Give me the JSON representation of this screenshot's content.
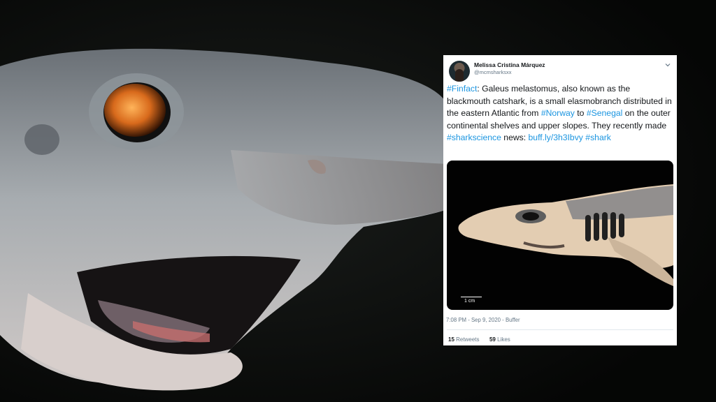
{
  "tweet": {
    "display_name": "Melissa Cristina Márquez",
    "handle": "@mcmsharksxx",
    "text_parts": [
      {
        "text": "#Finfact",
        "link": true
      },
      {
        "text": ": Galeus melastomus, also known as the blackmouth catshark, is a small elasmobranch distributed in the eastern Atlantic from ",
        "link": false
      },
      {
        "text": "#Norway",
        "link": true
      },
      {
        "text": " to ",
        "link": false
      },
      {
        "text": "#Senegal",
        "link": true
      },
      {
        "text": " on the outer continental shelves and upper slopes. They recently made ",
        "link": false
      },
      {
        "text": "#sharkscience",
        "link": true
      },
      {
        "text": " news: ",
        "link": false
      },
      {
        "text": "buff.ly/3h3Ibvy",
        "link": true
      },
      {
        "text": " ",
        "link": false
      },
      {
        "text": "#shark",
        "link": true
      }
    ],
    "media_scale_label": "1 cm",
    "timestamp": "7:08 PM - Sep 9, 2020 - Buffer",
    "retweets_count": "15",
    "retweets_label": "Retweets",
    "likes_count": "59",
    "likes_label": "Likes"
  },
  "colors": {
    "link": "#1b95e0",
    "text": "#14171a",
    "muted": "#657786",
    "background": "#0b0c0b"
  },
  "icons": {
    "menu": "chevron-down-icon"
  }
}
